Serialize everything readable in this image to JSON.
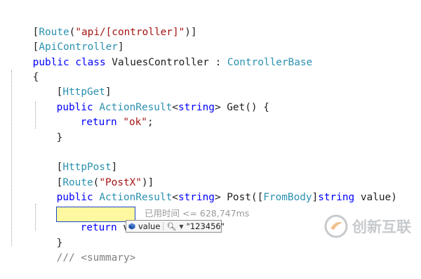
{
  "editor": {
    "lines": {
      "l1": {
        "t1": "[",
        "t2": "Route",
        "t3": "(",
        "t4": "\"api/[controller]\"",
        "t5": ")]"
      },
      "l2": {
        "t1": "[",
        "t2": "ApiController",
        "t3": "]"
      },
      "l3": {
        "t1": "public",
        "t2": " ",
        "t3": "class",
        "t4": " ValuesController : ",
        "t5": "ControllerBase"
      },
      "l4": {
        "t1": "{"
      },
      "l5": {
        "t1": "[",
        "t2": "HttpGet",
        "t3": "]"
      },
      "l6": {
        "t1": "public",
        "t2": " ",
        "t3": "ActionResult",
        "t4": "<",
        "t5": "string",
        "t6": "> Get() {"
      },
      "l7": {
        "t1": "return",
        "t2": " ",
        "t3": "\"ok\"",
        "t4": ";"
      },
      "l8": {
        "t1": "}"
      },
      "l10": {
        "t1": "[",
        "t2": "HttpPost",
        "t3": "]"
      },
      "l11": {
        "t1": "[",
        "t2": "Route",
        "t3": "(",
        "t4": "\"PostX\"",
        "t5": ")]"
      },
      "l12": {
        "t1": "public",
        "t2": " ",
        "t3": "ActionResult",
        "t4": "<",
        "t5": "string",
        "t6": "> Post([",
        "t7": "FromBody",
        "t8": "]",
        "t9": "string",
        "t10": " value)"
      },
      "l13": {
        "t1": "{"
      },
      "l14": {
        "t1": "return",
        "t2": " value;"
      },
      "l15": {
        "t1": "}"
      },
      "l16": {
        "t1": "/// <summary>"
      }
    },
    "perf_tip": "已用时间 <= 628,747ms",
    "datatip": {
      "name": "value",
      "value": "\"123456\""
    }
  },
  "watermark": {
    "text": "创新互联"
  },
  "colors": {
    "keyword": "#0000ff",
    "type": "#2b91af",
    "string": "#a31515",
    "highlight": "#fff8a0"
  }
}
